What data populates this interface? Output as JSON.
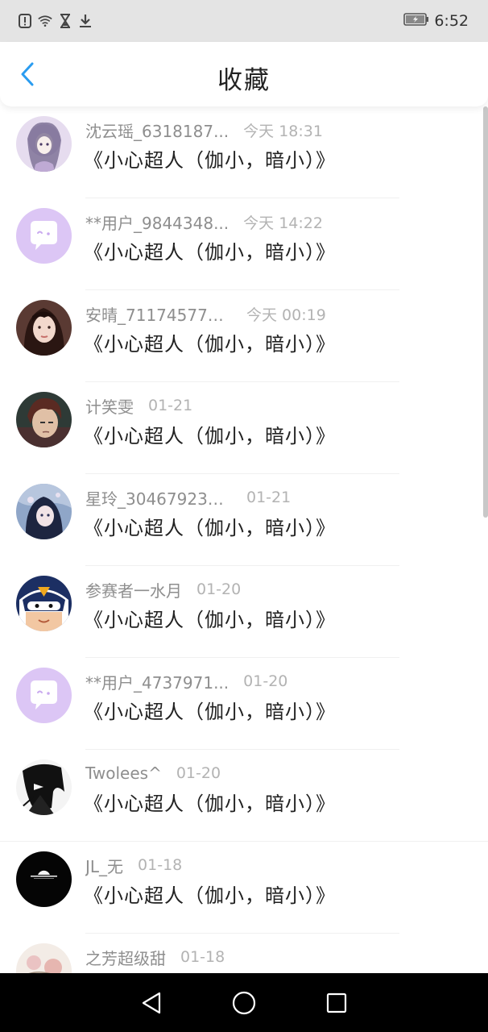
{
  "status_bar": {
    "time": "6:52",
    "icons": [
      "alert-icon",
      "wifi-icon",
      "hourglass-icon",
      "download-icon",
      "battery-icon"
    ]
  },
  "header": {
    "title": "收藏",
    "back_icon": "chevron-left-icon"
  },
  "favorites": [
    {
      "name": "沈云瑶_6318187...",
      "time": "今天 18:31",
      "song": "《小心超人（伽小，暗小）》",
      "avatar": "anime-girl"
    },
    {
      "name": "**用户_9844348...",
      "time": "今天 14:22",
      "song": "《小心超人（伽小，暗小）》",
      "avatar": "default-chat"
    },
    {
      "name": "安晴_711745776...",
      "time": "今天 00:19",
      "song": "《小心超人（伽小，暗小）》",
      "avatar": "photo-girl"
    },
    {
      "name": "计笑雯",
      "time": "01-21",
      "song": "《小心超人（伽小，暗小）》",
      "avatar": "anime-boy"
    },
    {
      "name": "星玲_304679232...",
      "time": "01-21",
      "song": "《小心超人（伽小，暗小）》",
      "avatar": "anime-dark"
    },
    {
      "name": "参赛者一水月",
      "time": "01-20",
      "song": "《小心超人（伽小，暗小）》",
      "avatar": "masked-hero"
    },
    {
      "name": "**用户_4737971...",
      "time": "01-20",
      "song": "《小心超人（伽小，暗小）》",
      "avatar": "default-chat"
    },
    {
      "name": "Twolees^",
      "time": "01-20",
      "song": "《小心超人（伽小，暗小）》",
      "avatar": "bw-sketch"
    },
    {
      "name": "JL_无",
      "time": "01-18",
      "song": "《小心超人（伽小，暗小）》",
      "avatar": "black-logo"
    },
    {
      "name": "之芳超级甜",
      "time": "01-18",
      "song": "",
      "avatar": "floral"
    }
  ],
  "nav_bar": {
    "icons": [
      "back-triangle-icon",
      "home-circle-icon",
      "recents-square-icon"
    ]
  }
}
